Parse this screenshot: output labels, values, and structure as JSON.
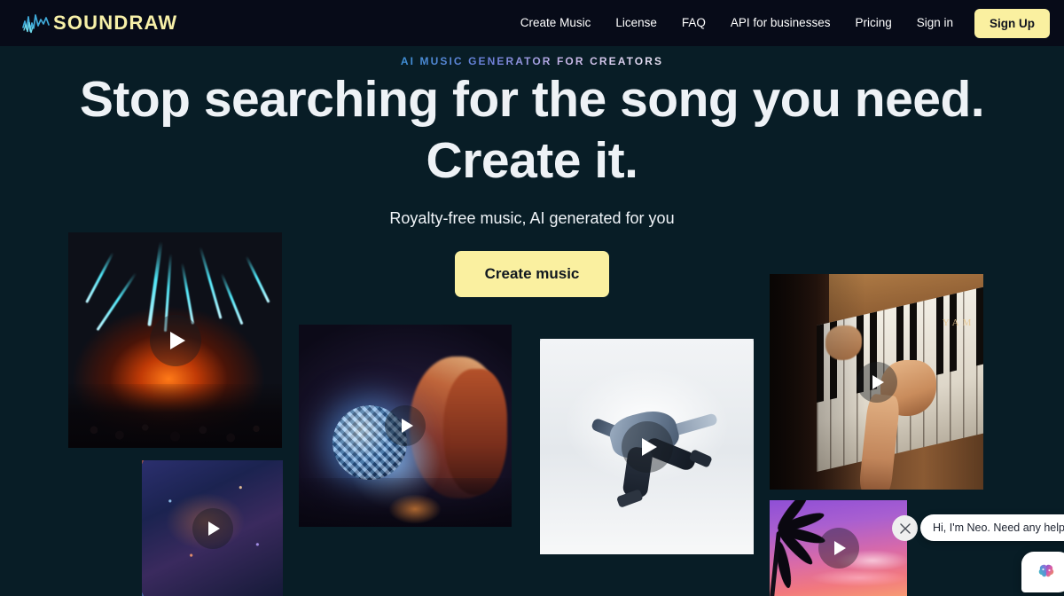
{
  "navbar": {
    "logo_text": "SOUNDRAW",
    "logo_mark": "waveform-icon",
    "links": [
      {
        "label": "Create Music"
      },
      {
        "label": "License"
      },
      {
        "label": "FAQ"
      },
      {
        "label": "API for businesses"
      },
      {
        "label": "Pricing"
      },
      {
        "label": "Sign in"
      }
    ],
    "signup_label": "Sign Up",
    "signup_color": "#faf0a0"
  },
  "hero": {
    "eyebrow": "AI MUSIC GENERATOR FOR CREATORS",
    "headline_line1": "Stop searching for the song you need.",
    "headline_line2": "Create it.",
    "subhead": "Royalty-free music, AI generated for you",
    "cta_label": "Create music",
    "cta_color": "#faf0a0",
    "background_color": "#081d26"
  },
  "collage": {
    "play_icon": "play-icon",
    "tiles": [
      {
        "name": "concert-lasers",
        "alt": "Concert crowd with teal laser beams and orange stage light"
      },
      {
        "name": "night-city",
        "alt": "Aerial view of neon-lit night city"
      },
      {
        "name": "disco-ball-woman",
        "alt": "Woman holding a glowing disco ball"
      },
      {
        "name": "breakdancer",
        "alt": "Breakdancer freezing on one hand in a white corridor"
      },
      {
        "name": "piano-hands",
        "alt": "Hands playing a Yamaha upright piano"
      },
      {
        "name": "palm-sunset",
        "alt": "Palm trees against a purple and pink sunset"
      }
    ]
  },
  "chat": {
    "message": "Hi, I'm Neo. Need any help?",
    "close_icon": "close-icon",
    "launcher_icon": "brain-icon"
  }
}
